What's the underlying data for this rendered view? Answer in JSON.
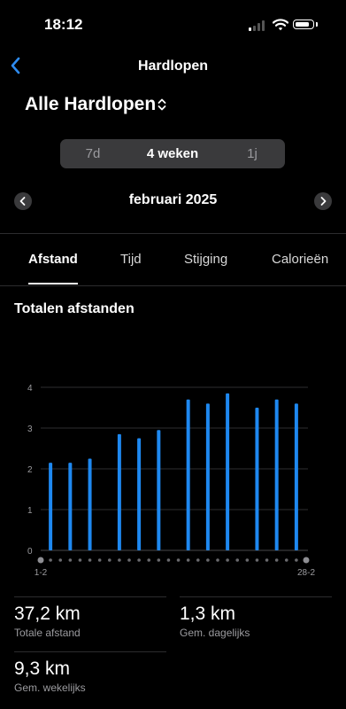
{
  "status": {
    "time": "18:12"
  },
  "nav": {
    "title": "Hardlopen"
  },
  "page": {
    "title": "Alle Hardlopen"
  },
  "segments": [
    {
      "label": "7d",
      "active": false
    },
    {
      "label": "4 weken",
      "active": true
    },
    {
      "label": "1j",
      "active": false
    }
  ],
  "period": {
    "label": "februari 2025"
  },
  "tabs": [
    {
      "label": "Afstand",
      "active": true
    },
    {
      "label": "Tijd",
      "active": false
    },
    {
      "label": "Stijging",
      "active": false
    },
    {
      "label": "Calorieën",
      "active": false
    }
  ],
  "section": {
    "title": "Totalen afstanden"
  },
  "chart_data": {
    "type": "bar",
    "title": "Totalen afstanden",
    "x_start_label": "1-2",
    "x_end_label": "28-2",
    "y_ticks": [
      "0",
      "1",
      "2",
      "3",
      "4"
    ],
    "ylim": [
      0,
      4.2
    ],
    "bar_color": "#1e88f0",
    "grid": true,
    "days": 28,
    "bars": [
      {
        "day": 2,
        "value": 2.15
      },
      {
        "day": 4,
        "value": 2.15
      },
      {
        "day": 6,
        "value": 2.25
      },
      {
        "day": 9,
        "value": 2.85
      },
      {
        "day": 11,
        "value": 2.75
      },
      {
        "day": 13,
        "value": 2.95
      },
      {
        "day": 16,
        "value": 3.7
      },
      {
        "day": 18,
        "value": 3.6
      },
      {
        "day": 20,
        "value": 3.85
      },
      {
        "day": 23,
        "value": 3.5
      },
      {
        "day": 25,
        "value": 3.7
      },
      {
        "day": 27,
        "value": 3.6
      }
    ]
  },
  "stats": [
    {
      "value": "37,2 km",
      "label": "Totale afstand"
    },
    {
      "value": "1,3 km",
      "label": "Gem. dagelijks"
    },
    {
      "value": "9,3 km",
      "label": "Gem. wekelijks"
    }
  ]
}
